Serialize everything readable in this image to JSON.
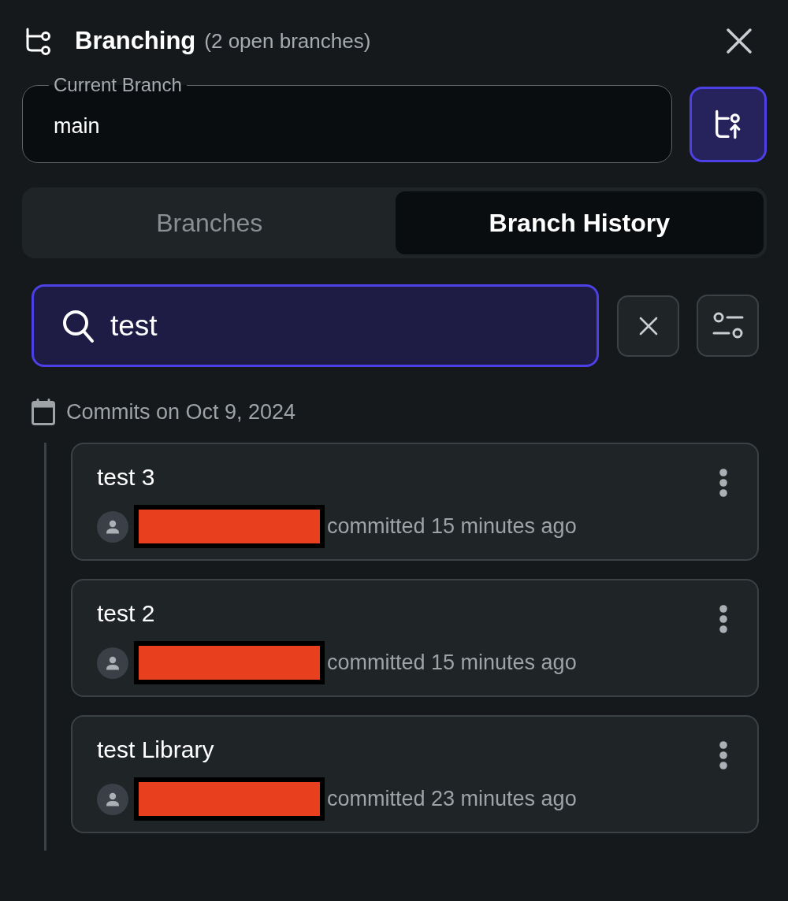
{
  "header": {
    "title": "Branching",
    "subtitle": "(2 open branches)"
  },
  "current_branch": {
    "label": "Current Branch",
    "value": "main"
  },
  "tabs": [
    {
      "label": "Branches",
      "selected": false
    },
    {
      "label": "Branch History",
      "selected": true
    }
  ],
  "search": {
    "value": "test",
    "focused": true
  },
  "commit_groups": [
    {
      "date": "Commits on Oct 9, 2024",
      "commits": [
        {
          "message": "test 3",
          "author_redacted": true,
          "time": "committed 15 minutes ago"
        },
        {
          "message": "test 2",
          "author_redacted": true,
          "time": "committed 15 minutes ago"
        },
        {
          "message": "test Library",
          "author_redacted": true,
          "time": "committed 23 minutes ago"
        }
      ]
    }
  ]
}
